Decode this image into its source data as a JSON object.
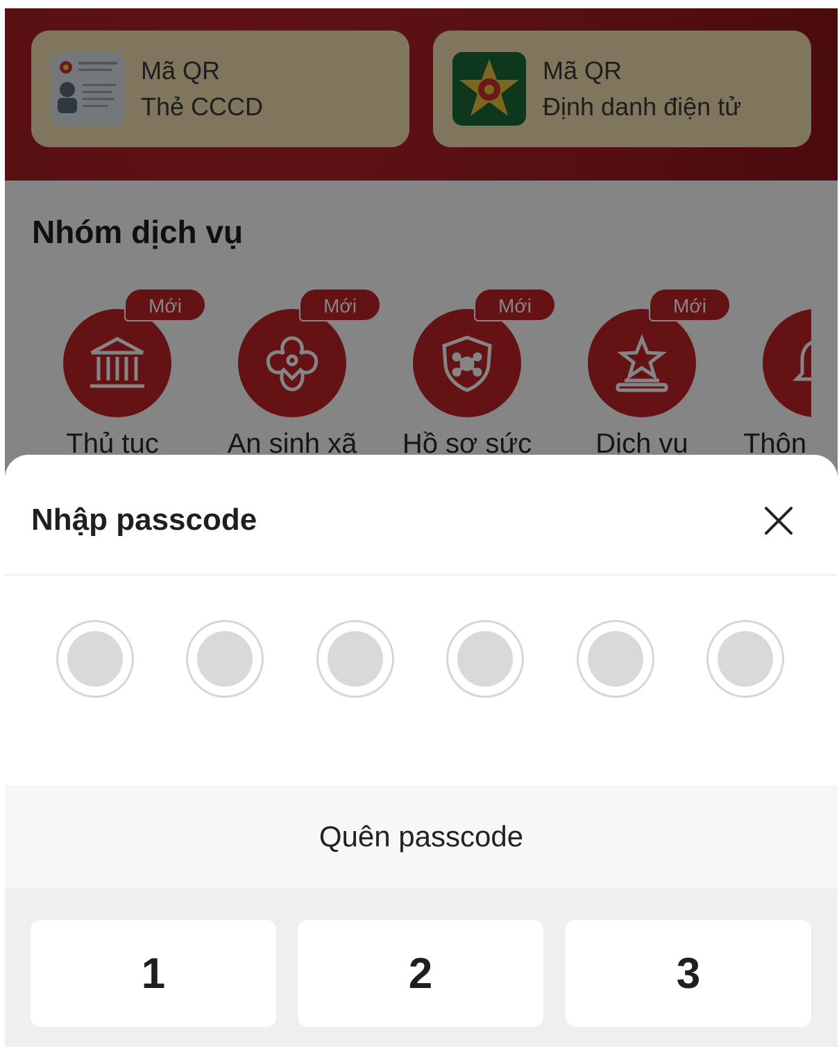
{
  "background": {
    "qr_cards": [
      {
        "title": "Mã QR",
        "subtitle": "Thẻ CCCD",
        "icon": "id-card-icon"
      },
      {
        "title": "Mã QR",
        "subtitle": "Định danh điện tử",
        "icon": "police-emblem-icon"
      }
    ],
    "services_title": "Nhóm dịch vụ",
    "services": [
      {
        "label": "Thủ tục",
        "badge": "Mới",
        "icon": "government-building-icon"
      },
      {
        "label": "An sinh xã",
        "badge": "Mới",
        "icon": "family-flower-icon"
      },
      {
        "label": "Hồ sơ sức",
        "badge": "Mới",
        "icon": "health-shield-icon"
      },
      {
        "label": "Dịch vụ",
        "badge": "Mới",
        "icon": "star-podium-icon"
      },
      {
        "label": "Thôn",
        "badge": "",
        "icon": "bell-icon"
      }
    ]
  },
  "sheet": {
    "title": "Nhập passcode",
    "close_icon": "close-icon",
    "pin_length": 6,
    "forgot_label": "Quên passcode",
    "keys": [
      "1",
      "2",
      "3"
    ]
  },
  "colors": {
    "brand_red": "#c1242a",
    "card_gold": "#f6e3b4",
    "pin_dot": "#d9d9d9"
  }
}
